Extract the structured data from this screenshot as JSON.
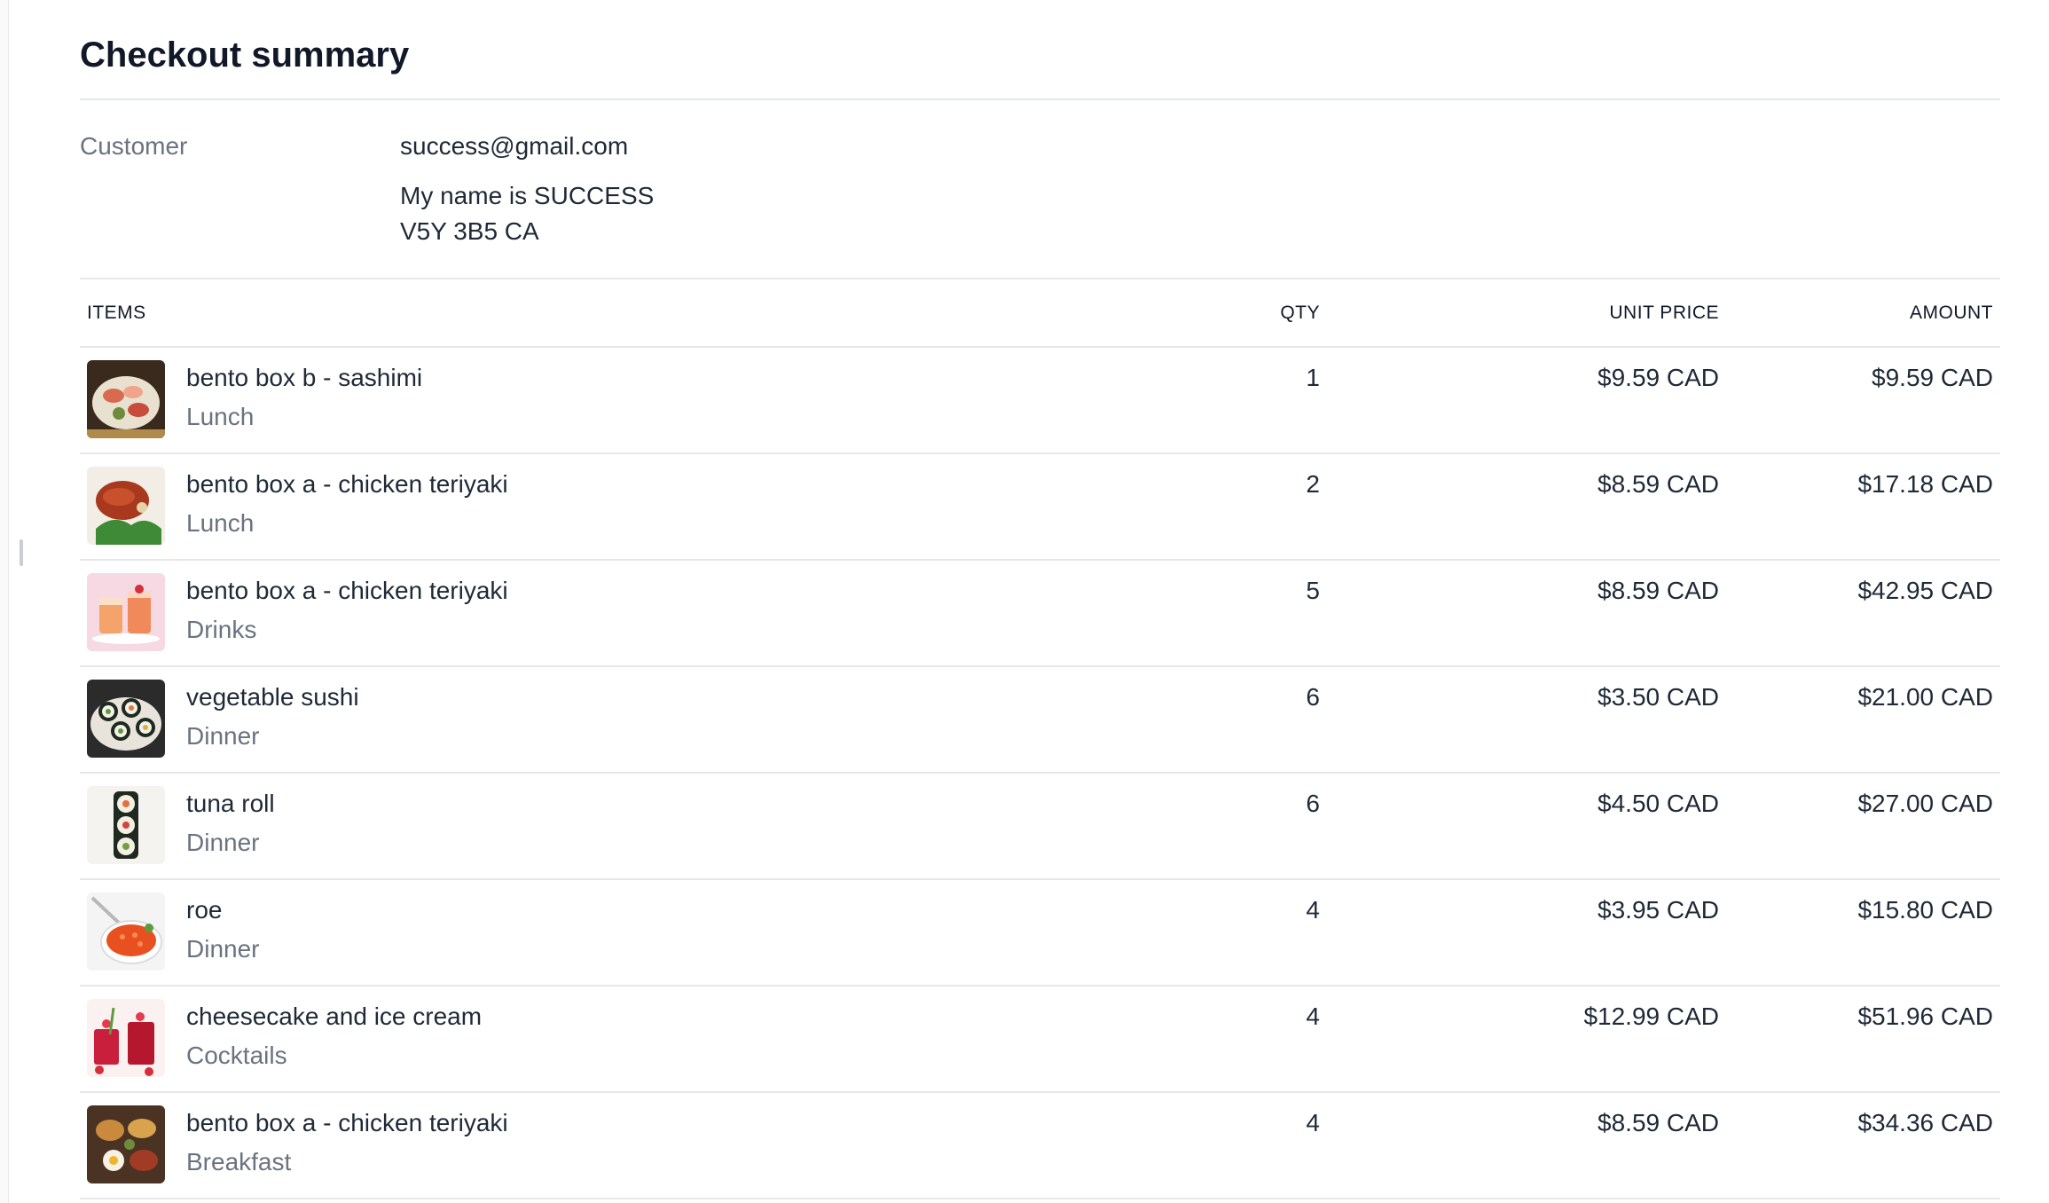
{
  "page": {
    "title": "Checkout summary"
  },
  "customer": {
    "label": "Customer",
    "email": "success@gmail.com",
    "name": "My name is SUCCESS",
    "postal": "V5Y 3B5 CA"
  },
  "table": {
    "headers": {
      "items": "ITEMS",
      "qty": "QTY",
      "unit_price": "UNIT PRICE",
      "amount": "AMOUNT"
    },
    "rows": [
      {
        "name": "bento box b - sashimi",
        "category": "Lunch",
        "qty": "1",
        "unit_price": "$9.59 CAD",
        "amount": "$9.59 CAD",
        "thumb_icon": "sashimi-plate-photo"
      },
      {
        "name": "bento box a - chicken teriyaki",
        "category": "Lunch",
        "qty": "2",
        "unit_price": "$8.59 CAD",
        "amount": "$17.18 CAD",
        "thumb_icon": "chicken-teriyaki-photo"
      },
      {
        "name": "bento box a - chicken teriyaki",
        "category": "Drinks",
        "qty": "5",
        "unit_price": "$8.59 CAD",
        "amount": "$42.95 CAD",
        "thumb_icon": "drinks-photo"
      },
      {
        "name": "vegetable sushi",
        "category": "Dinner",
        "qty": "6",
        "unit_price": "$3.50 CAD",
        "amount": "$21.00 CAD",
        "thumb_icon": "vegetable-sushi-photo"
      },
      {
        "name": "tuna roll",
        "category": "Dinner",
        "qty": "6",
        "unit_price": "$4.50 CAD",
        "amount": "$27.00 CAD",
        "thumb_icon": "tuna-roll-photo"
      },
      {
        "name": "roe",
        "category": "Dinner",
        "qty": "4",
        "unit_price": "$3.95 CAD",
        "amount": "$15.80 CAD",
        "thumb_icon": "roe-photo"
      },
      {
        "name": "cheesecake and ice cream",
        "category": "Cocktails",
        "qty": "4",
        "unit_price": "$12.99 CAD",
        "amount": "$51.96 CAD",
        "thumb_icon": "cocktails-photo"
      },
      {
        "name": "bento box a - chicken teriyaki",
        "category": "Breakfast",
        "qty": "4",
        "unit_price": "$8.59 CAD",
        "amount": "$34.36 CAD",
        "thumb_icon": "breakfast-platter-photo"
      }
    ]
  },
  "colors": {
    "text_primary": "#1f2937",
    "text_muted": "#6b7280",
    "divider": "#e5e7eb"
  }
}
